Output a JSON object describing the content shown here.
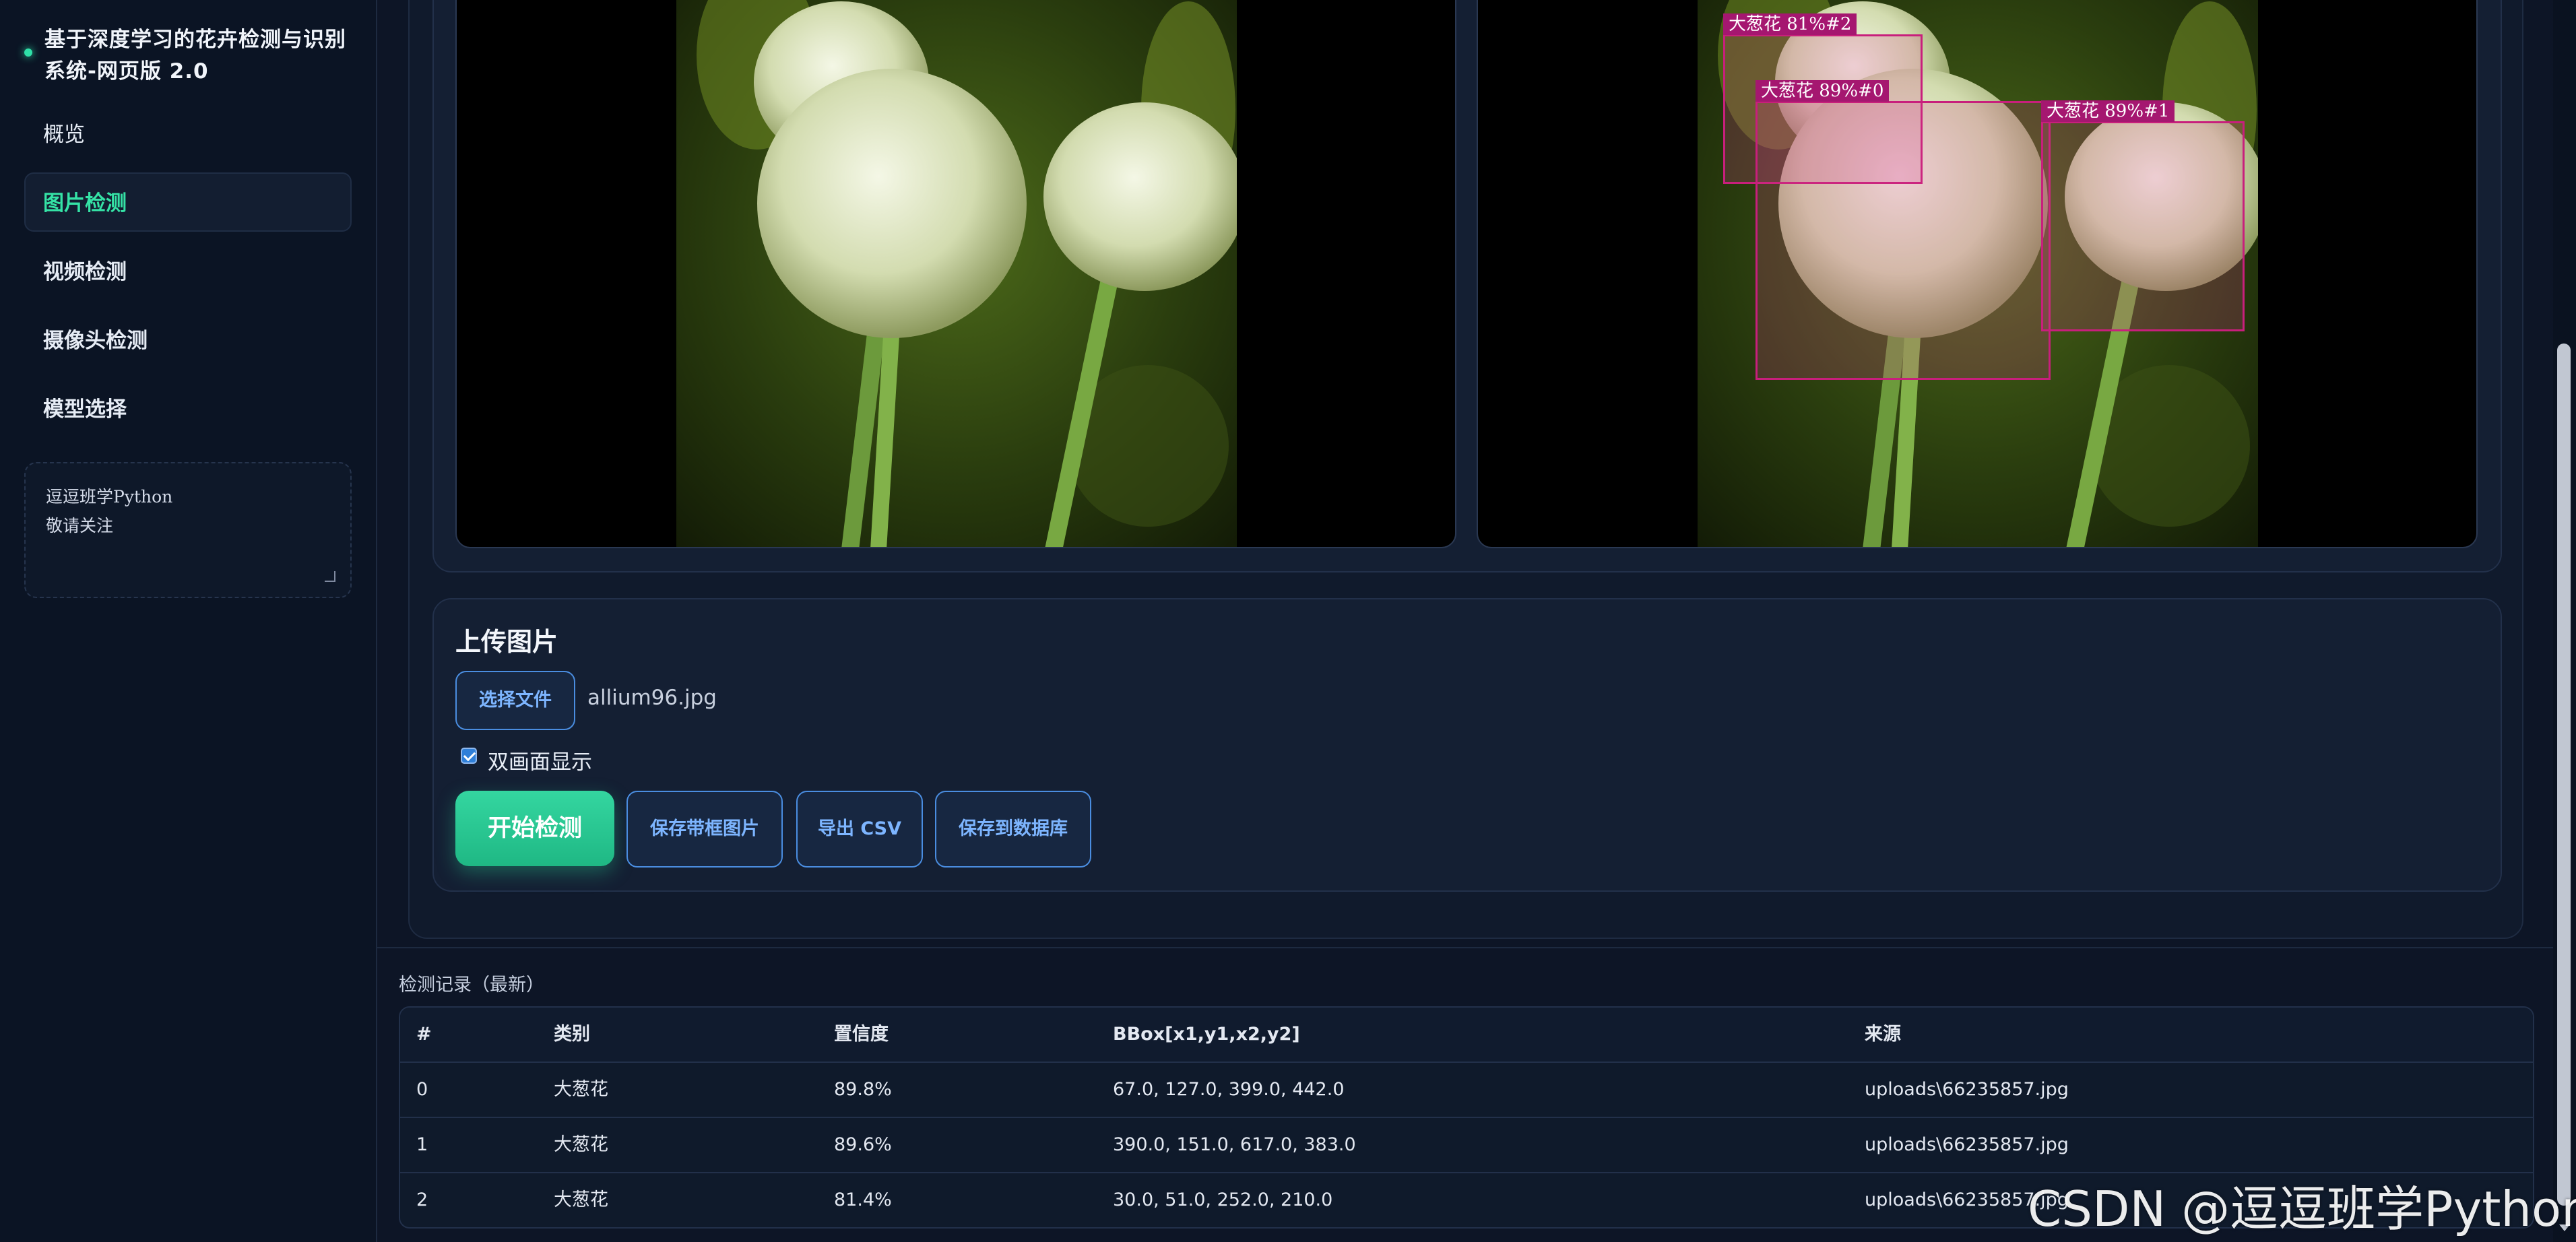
{
  "sidebar": {
    "brand": "基于深度学习的花卉检测与识别系统-网页版 2.0",
    "items": [
      {
        "label": "概览"
      },
      {
        "label": "图片检测"
      },
      {
        "label": "视频检测"
      },
      {
        "label": "摄像头检测"
      },
      {
        "label": "模型选择"
      }
    ],
    "note_line1": "逗逗班学Python",
    "note_line2": "敬请关注"
  },
  "viewer": {
    "detections": [
      {
        "label": "大葱花 81%#2"
      },
      {
        "label": "大葱花 89%#0"
      },
      {
        "label": "大葱花 89%#1"
      }
    ]
  },
  "upload": {
    "title": "上传图片",
    "choose_file": "选择文件",
    "file_name": "allium96.jpg",
    "dual_view_label": "双画面显示",
    "dual_view_checked": true,
    "start_button": "开始检测",
    "save_image_button": "保存带框图片",
    "export_csv_button": "导出 CSV",
    "save_db_button": "保存到数据库"
  },
  "records": {
    "title": "检测记录（最新）",
    "columns": [
      "#",
      "类别",
      "置信度",
      "BBox[x1,y1,x2,y2]",
      "来源"
    ],
    "rows": [
      [
        "0",
        "大葱花",
        "89.8%",
        "67.0, 127.0, 399.0, 442.0",
        "uploads\\66235857.jpg"
      ],
      [
        "1",
        "大葱花",
        "89.6%",
        "390.0, 151.0, 617.0, 383.0",
        "uploads\\66235857.jpg"
      ],
      [
        "2",
        "大葱花",
        "81.4%",
        "30.0, 51.0, 252.0, 210.0",
        "uploads\\66235857.jpg"
      ]
    ]
  },
  "watermark": "CSDN @逗逗班学Python",
  "colors": {
    "accent": "#35e3a6",
    "link_blue": "#7db5ff",
    "box_magenta": "#c81f7c"
  }
}
